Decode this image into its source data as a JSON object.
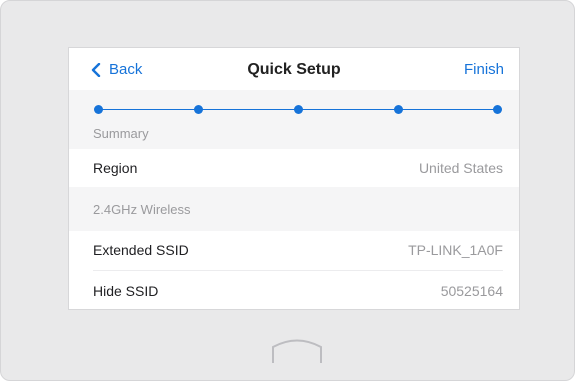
{
  "header": {
    "back_label": "Back",
    "title": "Quick Setup",
    "finish_label": "Finish"
  },
  "stepper": {
    "total_steps": 5,
    "current_step": 5
  },
  "sections": {
    "summary_label": "Summary",
    "wireless_label": "2.4GHz Wireless"
  },
  "rows": {
    "region": {
      "label": "Region",
      "value": "United States"
    },
    "extended_ssid": {
      "label": "Extended SSID",
      "value": "TP-LINK_1A0F"
    },
    "hide_ssid": {
      "label": "Hide SSID",
      "value": "50525164"
    }
  },
  "colors": {
    "accent": "#1673d9",
    "device_frame": "#e9e9ea",
    "muted_text": "#9a9a9d"
  },
  "icons": {
    "back": "chevron-left-icon",
    "home": "home-icon"
  }
}
